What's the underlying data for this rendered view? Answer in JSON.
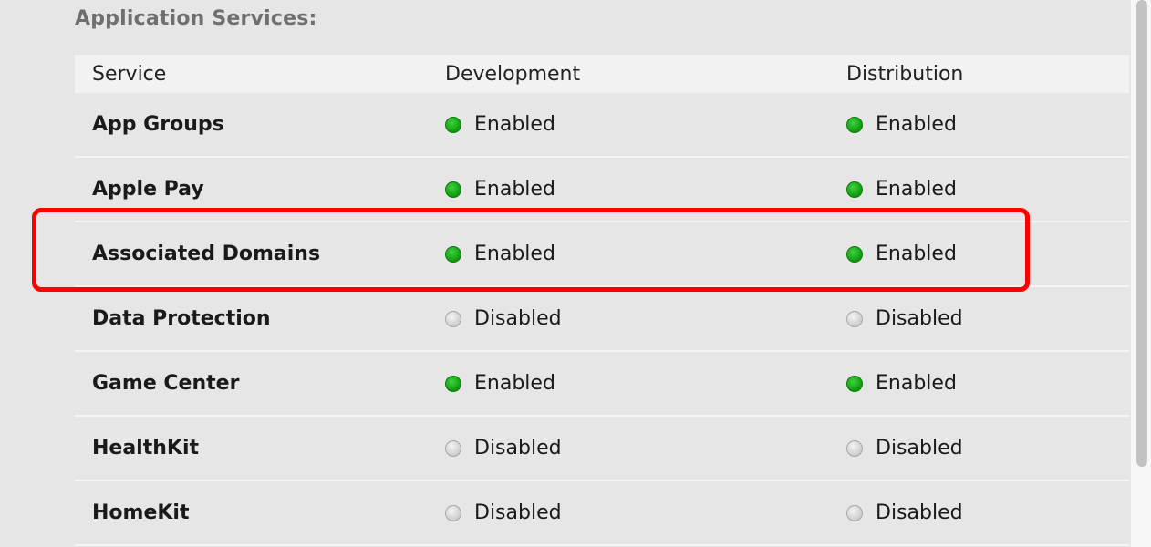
{
  "section": {
    "title": "Application Services:"
  },
  "table": {
    "headers": {
      "service": "Service",
      "development": "Development",
      "distribution": "Distribution"
    },
    "rows": [
      {
        "service": "App Groups",
        "development": "Enabled",
        "distribution": "Enabled"
      },
      {
        "service": "Apple Pay",
        "development": "Enabled",
        "distribution": "Enabled"
      },
      {
        "service": "Associated Domains",
        "development": "Enabled",
        "distribution": "Enabled"
      },
      {
        "service": "Data Protection",
        "development": "Disabled",
        "distribution": "Disabled"
      },
      {
        "service": "Game Center",
        "development": "Enabled",
        "distribution": "Enabled"
      },
      {
        "service": "HealthKit",
        "development": "Disabled",
        "distribution": "Disabled"
      },
      {
        "service": "HomeKit",
        "development": "Disabled",
        "distribution": "Disabled"
      }
    ]
  },
  "colors": {
    "enabled": "#17a617",
    "disabled": "#c8c8c8",
    "highlight": "#ff0000"
  },
  "icons": {
    "enabled": "green-status-dot-icon",
    "disabled": "gray-status-dot-icon"
  }
}
